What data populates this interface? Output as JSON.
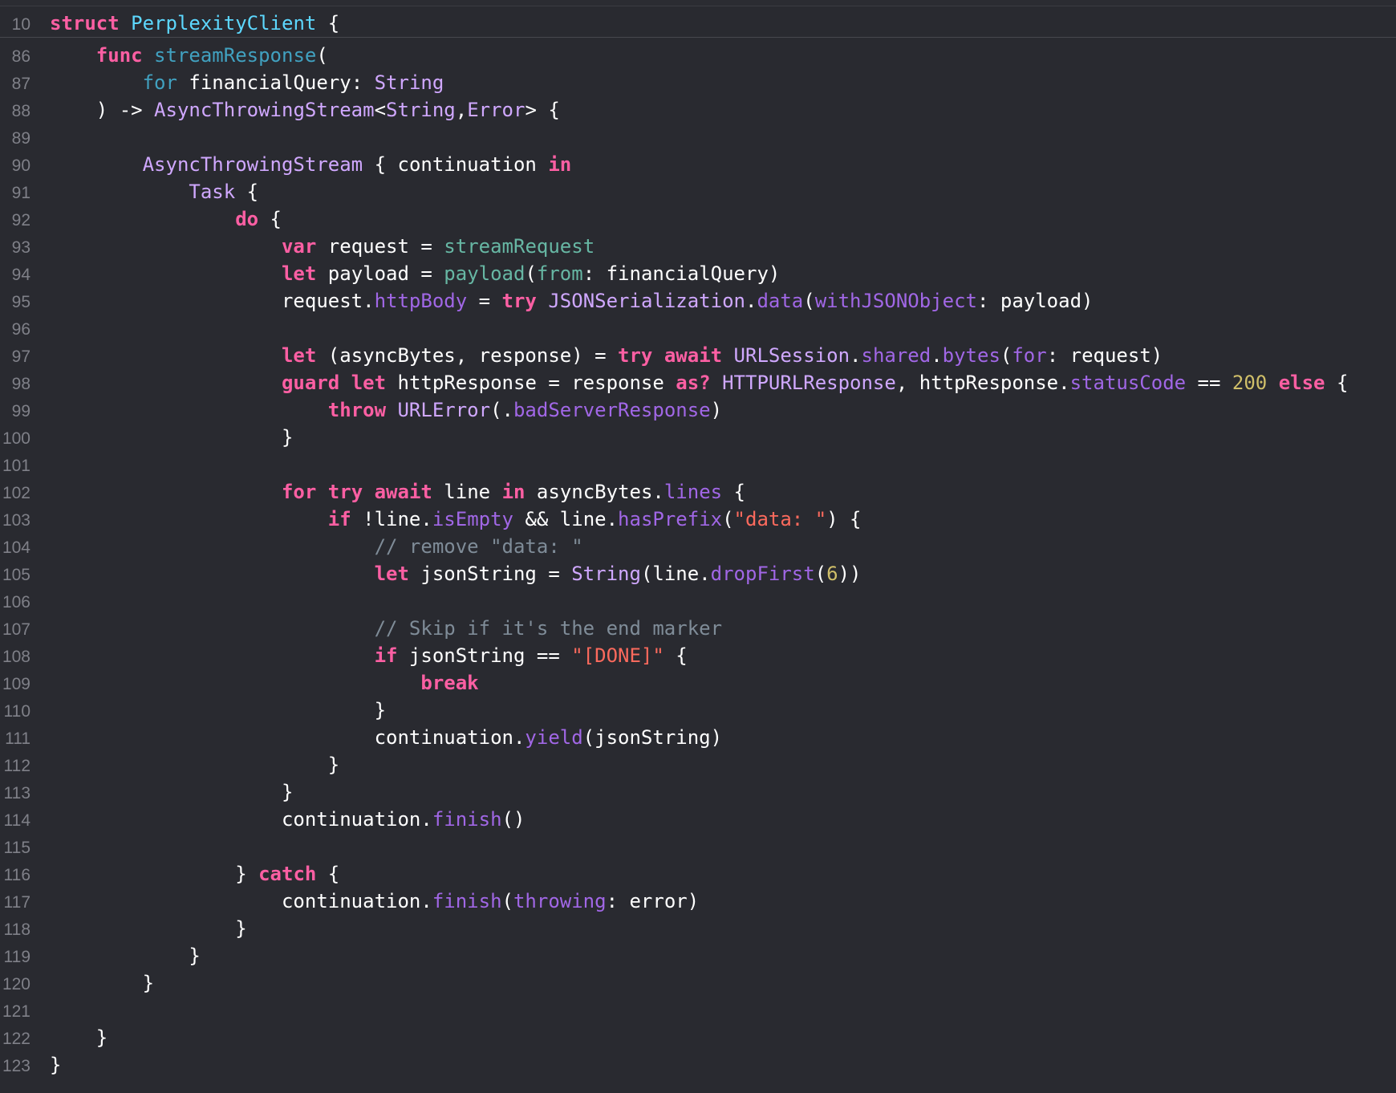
{
  "editor": {
    "sticky_header": {
      "line_number": "10",
      "tokens": [
        {
          "t": "struct",
          "c": "kw"
        },
        {
          "t": " ",
          "c": "plain"
        },
        {
          "t": "PerplexityClient",
          "c": "decl"
        },
        {
          "t": " {",
          "c": "plain"
        }
      ]
    },
    "lines": [
      {
        "n": "86",
        "tokens": [
          {
            "t": "    ",
            "c": "plain"
          },
          {
            "t": "func",
            "c": "kw"
          },
          {
            "t": " ",
            "c": "plain"
          },
          {
            "t": "streamResponse",
            "c": "fnname"
          },
          {
            "t": "(",
            "c": "plain"
          }
        ]
      },
      {
        "n": "87",
        "tokens": [
          {
            "t": "        ",
            "c": "plain"
          },
          {
            "t": "for",
            "c": "for"
          },
          {
            "t": " financialQuery: ",
            "c": "plain"
          },
          {
            "t": "String",
            "c": "type"
          }
        ]
      },
      {
        "n": "88",
        "tokens": [
          {
            "t": "    ) -> ",
            "c": "plain"
          },
          {
            "t": "AsyncThrowingStream",
            "c": "type"
          },
          {
            "t": "<",
            "c": "plain"
          },
          {
            "t": "String",
            "c": "type"
          },
          {
            "t": ",",
            "c": "plain"
          },
          {
            "t": "Error",
            "c": "type"
          },
          {
            "t": "> {",
            "c": "plain"
          }
        ]
      },
      {
        "n": "89",
        "tokens": []
      },
      {
        "n": "90",
        "tokens": [
          {
            "t": "        ",
            "c": "plain"
          },
          {
            "t": "AsyncThrowingStream",
            "c": "type"
          },
          {
            "t": " { continuation ",
            "c": "plain"
          },
          {
            "t": "in",
            "c": "kw"
          }
        ]
      },
      {
        "n": "91",
        "tokens": [
          {
            "t": "            ",
            "c": "plain"
          },
          {
            "t": "Task",
            "c": "type"
          },
          {
            "t": " {",
            "c": "plain"
          }
        ]
      },
      {
        "n": "92",
        "tokens": [
          {
            "t": "                ",
            "c": "plain"
          },
          {
            "t": "do",
            "c": "kw"
          },
          {
            "t": " {",
            "c": "plain"
          }
        ]
      },
      {
        "n": "93",
        "tokens": [
          {
            "t": "                    ",
            "c": "plain"
          },
          {
            "t": "var",
            "c": "kw"
          },
          {
            "t": " request = ",
            "c": "plain"
          },
          {
            "t": "streamRequest",
            "c": "fnuse"
          }
        ]
      },
      {
        "n": "94",
        "tokens": [
          {
            "t": "                    ",
            "c": "plain"
          },
          {
            "t": "let",
            "c": "kw"
          },
          {
            "t": " payload = ",
            "c": "plain"
          },
          {
            "t": "payload",
            "c": "fnuse"
          },
          {
            "t": "(",
            "c": "plain"
          },
          {
            "t": "from",
            "c": "fnuse"
          },
          {
            "t": ": financialQuery)",
            "c": "plain"
          }
        ]
      },
      {
        "n": "95",
        "tokens": [
          {
            "t": "                    request.",
            "c": "plain"
          },
          {
            "t": "httpBody",
            "c": "call"
          },
          {
            "t": " = ",
            "c": "plain"
          },
          {
            "t": "try",
            "c": "kw"
          },
          {
            "t": " ",
            "c": "plain"
          },
          {
            "t": "JSONSerialization",
            "c": "type"
          },
          {
            "t": ".",
            "c": "plain"
          },
          {
            "t": "data",
            "c": "call"
          },
          {
            "t": "(",
            "c": "plain"
          },
          {
            "t": "withJSONObject",
            "c": "call"
          },
          {
            "t": ": payload)",
            "c": "plain"
          }
        ]
      },
      {
        "n": "96",
        "tokens": []
      },
      {
        "n": "97",
        "tokens": [
          {
            "t": "                    ",
            "c": "plain"
          },
          {
            "t": "let",
            "c": "kw"
          },
          {
            "t": " (asyncBytes, response) = ",
            "c": "plain"
          },
          {
            "t": "try",
            "c": "kw"
          },
          {
            "t": " ",
            "c": "plain"
          },
          {
            "t": "await",
            "c": "kw"
          },
          {
            "t": " ",
            "c": "plain"
          },
          {
            "t": "URLSession",
            "c": "type"
          },
          {
            "t": ".",
            "c": "plain"
          },
          {
            "t": "shared",
            "c": "call"
          },
          {
            "t": ".",
            "c": "plain"
          },
          {
            "t": "bytes",
            "c": "call"
          },
          {
            "t": "(",
            "c": "plain"
          },
          {
            "t": "for",
            "c": "call"
          },
          {
            "t": ": request)",
            "c": "plain"
          }
        ]
      },
      {
        "n": "98",
        "tokens": [
          {
            "t": "                    ",
            "c": "plain"
          },
          {
            "t": "guard",
            "c": "kw"
          },
          {
            "t": " ",
            "c": "plain"
          },
          {
            "t": "let",
            "c": "kw"
          },
          {
            "t": " httpResponse = response ",
            "c": "plain"
          },
          {
            "t": "as?",
            "c": "kw"
          },
          {
            "t": " ",
            "c": "plain"
          },
          {
            "t": "HTTPURLResponse",
            "c": "type"
          },
          {
            "t": ", httpResponse.",
            "c": "plain"
          },
          {
            "t": "statusCode",
            "c": "call"
          },
          {
            "t": " == ",
            "c": "plain"
          },
          {
            "t": "200",
            "c": "num"
          },
          {
            "t": " ",
            "c": "plain"
          },
          {
            "t": "else",
            "c": "kw"
          },
          {
            "t": " {",
            "c": "plain"
          }
        ]
      },
      {
        "n": "99",
        "tokens": [
          {
            "t": "                        ",
            "c": "plain"
          },
          {
            "t": "throw",
            "c": "kw"
          },
          {
            "t": " ",
            "c": "plain"
          },
          {
            "t": "URLError",
            "c": "type"
          },
          {
            "t": "(.",
            "c": "plain"
          },
          {
            "t": "badServerResponse",
            "c": "call"
          },
          {
            "t": ")",
            "c": "plain"
          }
        ]
      },
      {
        "n": "100",
        "tokens": [
          {
            "t": "                    }",
            "c": "plain"
          }
        ]
      },
      {
        "n": "101",
        "tokens": []
      },
      {
        "n": "102",
        "tokens": [
          {
            "t": "                    ",
            "c": "plain"
          },
          {
            "t": "for",
            "c": "kw"
          },
          {
            "t": " ",
            "c": "plain"
          },
          {
            "t": "try",
            "c": "kw"
          },
          {
            "t": " ",
            "c": "plain"
          },
          {
            "t": "await",
            "c": "kw"
          },
          {
            "t": " line ",
            "c": "plain"
          },
          {
            "t": "in",
            "c": "kw"
          },
          {
            "t": " asyncBytes.",
            "c": "plain"
          },
          {
            "t": "lines",
            "c": "call"
          },
          {
            "t": " {",
            "c": "plain"
          }
        ]
      },
      {
        "n": "103",
        "tokens": [
          {
            "t": "                        ",
            "c": "plain"
          },
          {
            "t": "if",
            "c": "kw"
          },
          {
            "t": " !line.",
            "c": "plain"
          },
          {
            "t": "isEmpty",
            "c": "call"
          },
          {
            "t": " && line.",
            "c": "plain"
          },
          {
            "t": "hasPrefix",
            "c": "call"
          },
          {
            "t": "(",
            "c": "plain"
          },
          {
            "t": "\"data: \"",
            "c": "str"
          },
          {
            "t": ") {",
            "c": "plain"
          }
        ]
      },
      {
        "n": "104",
        "tokens": [
          {
            "t": "                            ",
            "c": "plain"
          },
          {
            "t": "// remove \"data: \"",
            "c": "cmt"
          }
        ]
      },
      {
        "n": "105",
        "tokens": [
          {
            "t": "                            ",
            "c": "plain"
          },
          {
            "t": "let",
            "c": "kw"
          },
          {
            "t": " jsonString = ",
            "c": "plain"
          },
          {
            "t": "String",
            "c": "type"
          },
          {
            "t": "(line.",
            "c": "plain"
          },
          {
            "t": "dropFirst",
            "c": "call"
          },
          {
            "t": "(",
            "c": "plain"
          },
          {
            "t": "6",
            "c": "num"
          },
          {
            "t": "))",
            "c": "plain"
          }
        ]
      },
      {
        "n": "106",
        "tokens": []
      },
      {
        "n": "107",
        "tokens": [
          {
            "t": "                            ",
            "c": "plain"
          },
          {
            "t": "// Skip if it's the end marker",
            "c": "cmt"
          }
        ]
      },
      {
        "n": "108",
        "tokens": [
          {
            "t": "                            ",
            "c": "plain"
          },
          {
            "t": "if",
            "c": "kw"
          },
          {
            "t": " jsonString == ",
            "c": "plain"
          },
          {
            "t": "\"[DONE]\"",
            "c": "str"
          },
          {
            "t": " {",
            "c": "plain"
          }
        ]
      },
      {
        "n": "109",
        "tokens": [
          {
            "t": "                                ",
            "c": "plain"
          },
          {
            "t": "break",
            "c": "kw"
          }
        ]
      },
      {
        "n": "110",
        "tokens": [
          {
            "t": "                            }",
            "c": "plain"
          }
        ]
      },
      {
        "n": "111",
        "tokens": [
          {
            "t": "                            continuation.",
            "c": "plain"
          },
          {
            "t": "yield",
            "c": "call"
          },
          {
            "t": "(jsonString)",
            "c": "plain"
          }
        ]
      },
      {
        "n": "112",
        "tokens": [
          {
            "t": "                        }",
            "c": "plain"
          }
        ]
      },
      {
        "n": "113",
        "tokens": [
          {
            "t": "                    }",
            "c": "plain"
          }
        ]
      },
      {
        "n": "114",
        "tokens": [
          {
            "t": "                    continuation.",
            "c": "plain"
          },
          {
            "t": "finish",
            "c": "call"
          },
          {
            "t": "()",
            "c": "plain"
          }
        ]
      },
      {
        "n": "115",
        "tokens": []
      },
      {
        "n": "116",
        "tokens": [
          {
            "t": "                } ",
            "c": "plain"
          },
          {
            "t": "catch",
            "c": "kw"
          },
          {
            "t": " {",
            "c": "plain"
          }
        ]
      },
      {
        "n": "117",
        "tokens": [
          {
            "t": "                    continuation.",
            "c": "plain"
          },
          {
            "t": "finish",
            "c": "call"
          },
          {
            "t": "(",
            "c": "plain"
          },
          {
            "t": "throwing",
            "c": "call"
          },
          {
            "t": ": error)",
            "c": "plain"
          }
        ]
      },
      {
        "n": "118",
        "tokens": [
          {
            "t": "                }",
            "c": "plain"
          }
        ]
      },
      {
        "n": "119",
        "tokens": [
          {
            "t": "            }",
            "c": "plain"
          }
        ]
      },
      {
        "n": "120",
        "tokens": [
          {
            "t": "        }",
            "c": "plain"
          }
        ]
      },
      {
        "n": "121",
        "tokens": []
      },
      {
        "n": "122",
        "tokens": [
          {
            "t": "    }",
            "c": "plain"
          }
        ]
      },
      {
        "n": "123",
        "tokens": [
          {
            "t": "}",
            "c": "plain"
          }
        ]
      }
    ]
  },
  "colors": {
    "background": "#292a30",
    "keyword": "#fc5fa3",
    "type": "#d0a8ff",
    "declaration": "#5dd8ff",
    "call": "#a167e6",
    "string": "#fc6a5d",
    "number": "#d0bf69",
    "comment": "#7f8c98",
    "line_number": "#7f8088"
  }
}
